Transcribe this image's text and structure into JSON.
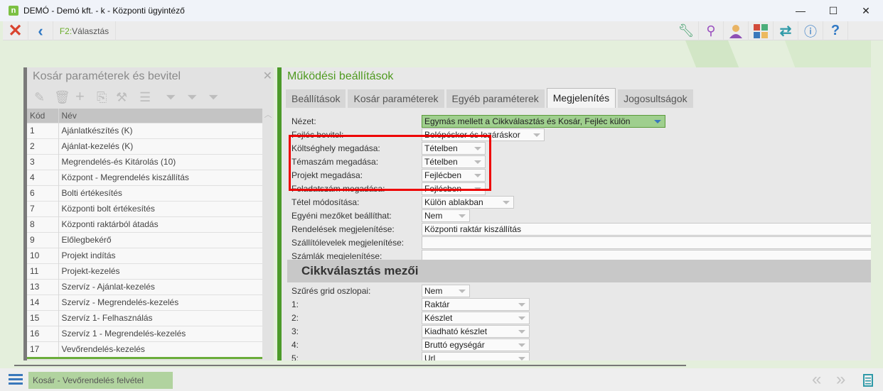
{
  "window": {
    "title": "DEMÓ - Demó kft. - k - Központi ügyintéző",
    "logo": "n",
    "minimize": "—",
    "maximize": "☐",
    "close": "✕"
  },
  "toolbar": {
    "f2_key": "F2:",
    "f2_label": "Választás",
    "icons": [
      "wrench-icon",
      "search-icon",
      "user-icon",
      "tiles-icon",
      "swap-icon",
      "info-icon",
      "help-icon"
    ]
  },
  "left_panel": {
    "title": "Kosár paraméterek és bevitel",
    "columns": [
      "Kód",
      "Név"
    ],
    "rows": [
      [
        "1",
        "Ajánlatkészítés (K)"
      ],
      [
        "2",
        "Ajánlat-kezelés (K)"
      ],
      [
        "3",
        "Megrendelés-és Kitárolás (10)"
      ],
      [
        "4",
        "Központ - Megrendelés kiszállítás"
      ],
      [
        "6",
        "Bolti értékesítés"
      ],
      [
        "7",
        "Központi bolt értékesítés"
      ],
      [
        "8",
        "Központi raktárból átadás"
      ],
      [
        "9",
        "Előlegbekérő"
      ],
      [
        "10",
        "Projekt indítás"
      ],
      [
        "11",
        "Projekt-kezelés"
      ],
      [
        "13",
        "Szervíz - Ajánlat-kezelés"
      ],
      [
        "14",
        "Szervíz - Megrendelés-kezelés"
      ],
      [
        "15",
        "Szervíz 1- Felhasználás"
      ],
      [
        "16",
        "Szervíz 1 - Megrendelés-kezelés"
      ],
      [
        "17",
        "Vevőrendelés-kezelés"
      ]
    ]
  },
  "right_panel": {
    "title": "Működési beállítások",
    "tabs": [
      "Beállítások",
      "Kosár paraméterek",
      "Egyéb paraméterek",
      "Megjelenítés",
      "Jogosultságok"
    ],
    "active_tab": "Megjelenítés",
    "fields": [
      {
        "label": "Nézet:",
        "value": "Egymás mellett a Cikkválasztás és Kosár, Fejléc külön"
      },
      {
        "label": "Fejléc bevitel:",
        "value": "Belépéskor és lezáráskor"
      },
      {
        "label": "Költséghely megadása:",
        "value": "Tételben"
      },
      {
        "label": "Témaszám megadása:",
        "value": "Tételben"
      },
      {
        "label": "Projekt megadása:",
        "value": "Fejlécben"
      },
      {
        "label": "Feladatszám megadása:",
        "value": "Fejlécben"
      },
      {
        "label": "Tétel módosítása:",
        "value": "Külön ablakban"
      },
      {
        "label": "Egyéni mezőket beállíthat:",
        "value": "Nem"
      },
      {
        "label": "Rendelések megjelenítése:",
        "value": "Központi raktár kiszállítás"
      },
      {
        "label": "Szállítólevelek megjelenítése:",
        "value": ""
      },
      {
        "label": "Számlák megjelenítése:",
        "value": ""
      }
    ],
    "section_title": "Cikkválasztás mezői",
    "section_fields": [
      {
        "label": "Szűrés grid oszlopai:",
        "value": "Nem"
      },
      {
        "label": "1:",
        "value": "Raktár"
      },
      {
        "label": "2:",
        "value": "Készlet"
      },
      {
        "label": "3:",
        "value": "Kiadható készlet"
      },
      {
        "label": "4:",
        "value": "Bruttó egységár"
      },
      {
        "label": "5:",
        "value": "Url"
      }
    ]
  },
  "statusbar": {
    "label": "Kosár - Vevőrendelés felvétel"
  }
}
